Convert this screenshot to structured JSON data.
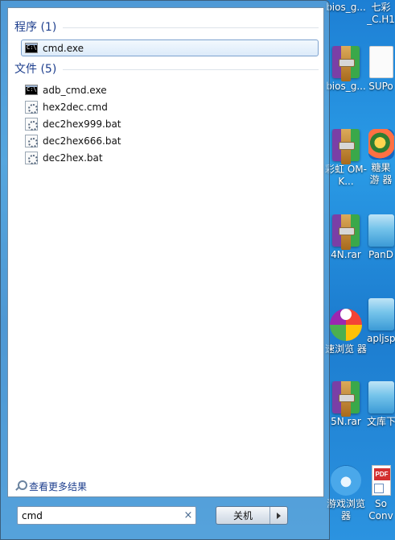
{
  "desktop": {
    "icons": [
      {
        "label": "bios_g...",
        "icon": "rar-archive-icon"
      },
      {
        "label": "七彩 _C.H1",
        "icon": "document-icon"
      },
      {
        "label": "bios_g...",
        "icon": "rar-archive-icon"
      },
      {
        "label": "SUPo",
        "icon": "document-icon"
      },
      {
        "label": "彩虹 OM-K...",
        "icon": "rar-archive-icon"
      },
      {
        "label": "糖果游 器",
        "icon": "candy-browser-icon"
      },
      {
        "label": "4N.rar",
        "icon": "rar-archive-icon"
      },
      {
        "label": "PanD",
        "icon": "folder-icon"
      },
      {
        "label": "速浏览 器",
        "icon": "browser-icon"
      },
      {
        "label": "apljsp",
        "icon": "folder-icon"
      },
      {
        "label": "5N.rar",
        "icon": "rar-archive-icon"
      },
      {
        "label": "文库下",
        "icon": "folder-icon"
      },
      {
        "label": "游戏浏览 器",
        "icon": "game-browser-icon"
      },
      {
        "label": "So Conv",
        "icon": "pdf-shortcut-icon"
      }
    ]
  },
  "start_menu": {
    "groups": [
      {
        "header": "程序 (1)",
        "items": [
          {
            "label": "cmd.exe",
            "icon": "cmd-icon",
            "selected": true
          }
        ]
      },
      {
        "header": "文件 (5)",
        "items": [
          {
            "label": "adb_cmd.exe",
            "icon": "cmd-icon"
          },
          {
            "label": "hex2dec.cmd",
            "icon": "batch-gear-icon"
          },
          {
            "label": "dec2hex999.bat",
            "icon": "batch-gear-icon"
          },
          {
            "label": "dec2hex666.bat",
            "icon": "batch-gear-icon"
          },
          {
            "label": "dec2hex.bat",
            "icon": "batch-gear-icon"
          }
        ]
      }
    ],
    "more_results": "查看更多结果",
    "search": {
      "value": "cmd",
      "clear_icon": "×"
    },
    "shutdown_label": "关机"
  },
  "colors": {
    "group_header": "#1e3f8e",
    "desktop_bg": "#1d7fd4",
    "selection_border": "#7da2ce"
  }
}
